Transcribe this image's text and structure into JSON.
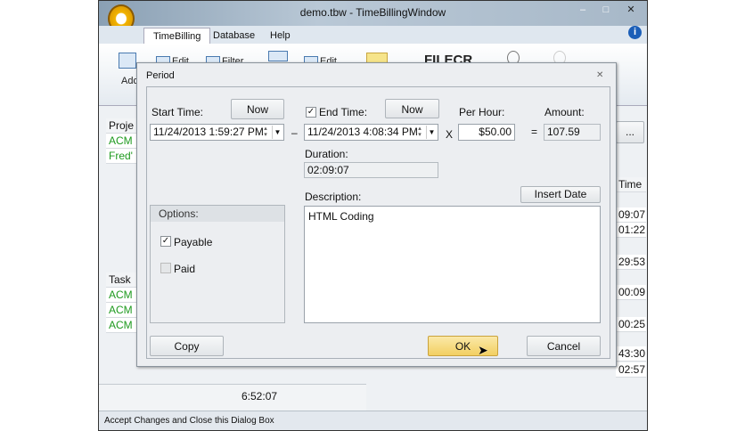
{
  "window": {
    "title": "demo.tbw - TimeBillingWindow",
    "min": "–",
    "max": "□",
    "close": "✕"
  },
  "tabs": [
    "TimeBilling",
    "Database",
    "Help"
  ],
  "ribbon": {
    "add": "Add",
    "edit1": "Edit",
    "filter": "Filter",
    "edit2": "Edit"
  },
  "watermark": "FILECR",
  "grid": {
    "project_header": "Proje",
    "projects": [
      "ACM",
      "Fred'"
    ],
    "task_header": "Task",
    "tasks": [
      "ACM",
      "ACM",
      "ACM"
    ],
    "more_button": "...",
    "time_header": "Time",
    "times": [
      "09:07",
      "01:22",
      "29:53",
      "00:09",
      "00:25",
      "43:30",
      "02:57"
    ],
    "total": "6:52:07"
  },
  "status": "Accept Changes and Close this Dialog Box",
  "dialog": {
    "title": "Period",
    "close": "✕",
    "start_label": "Start Time:",
    "now": "Now",
    "start_value": "11/24/2013 1:59:27 PM",
    "dash": "–",
    "end_label": "End Time:",
    "end_checked": true,
    "end_value": "11/24/2013 4:08:34 PM",
    "times_sign": "X",
    "per_hour_label": "Per Hour:",
    "per_hour_value": "$50.00",
    "equals": "=",
    "amount_label": "Amount:",
    "amount_value": "107.59",
    "duration_label": "Duration:",
    "duration_value": "02:09:07",
    "description_label": "Description:",
    "insert_date": "Insert Date",
    "description_value": "HTML Coding",
    "options_label": "Options:",
    "payable": "Payable",
    "payable_checked": true,
    "paid": "Paid",
    "paid_checked": false,
    "copy": "Copy",
    "ok": "OK",
    "cancel": "Cancel"
  }
}
